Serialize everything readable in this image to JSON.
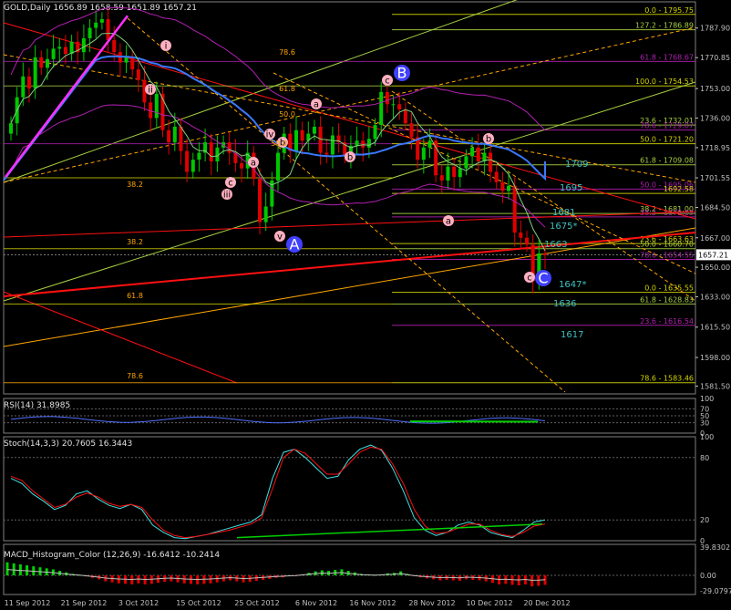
{
  "window": {
    "header": "GOLD,Daily  1656.89 1658.59 1651.89 1657.21",
    "rsi_header": "RSI(14) 31.8985",
    "stoch_header": "Stoch(14,3,3) 20.7605 16.3443",
    "macd_header": "MACD_Histogram_Color (12,26,9) -16.6412 -10.2414"
  },
  "colors": {
    "background": "#000000",
    "bull": "#00c800",
    "bear": "#e00000",
    "ma_blue": "#3a78ff",
    "trend_red": "#ff1010",
    "trend_orange": "#ffa500",
    "fib_yellow": "#d4d400",
    "fib_green": "#a8d040",
    "envelope": "#b020b0",
    "label_cyan": "#40c0c0",
    "label_pink": "#ffb0c0",
    "label_blue": "#8080ff"
  },
  "chart_data": {
    "type": "candlestick",
    "symbol": "GOLD",
    "timeframe": "Daily",
    "ylim": [
      1577,
      1803
    ],
    "price_ticks": [
      "1787.90",
      "1770.85",
      "1753.00",
      "1736.00",
      "1718.95",
      "1701.55",
      "1684.50",
      "1667.00",
      "1650.00",
      "1633.00",
      "1615.50",
      "1598.00",
      "1581.50"
    ],
    "last_price": "1657.21",
    "x_labels": [
      "11 Sep 2012",
      "21 Sep 2012",
      "3 Oct 2012",
      "15 Oct 2012",
      "25 Oct 2012",
      "6 Nov 2012",
      "16 Nov 2012",
      "28 Nov 2012",
      "10 Dec 2012",
      "20 Dec 2012"
    ],
    "closes": [
      1733,
      1748,
      1760,
      1753,
      1771,
      1765,
      1770,
      1776,
      1777,
      1773,
      1780,
      1774,
      1782,
      1788,
      1791,
      1793,
      1781,
      1774,
      1768,
      1771,
      1764,
      1758,
      1745,
      1736,
      1750,
      1729,
      1722,
      1731,
      1717,
      1705,
      1712,
      1716,
      1722,
      1711,
      1719,
      1722,
      1716,
      1710,
      1707,
      1716,
      1701,
      1676,
      1685,
      1700,
      1716,
      1727,
      1717,
      1729,
      1723,
      1727,
      1731,
      1716,
      1715,
      1726,
      1722,
      1714,
      1720,
      1723,
      1719,
      1724,
      1732,
      1751,
      1744,
      1744,
      1741,
      1733,
      1725,
      1712,
      1719,
      1723,
      1703,
      1700,
      1708,
      1702,
      1707,
      1714,
      1719,
      1711,
      1716,
      1705,
      1699,
      1694,
      1697,
      1670,
      1667,
      1663,
      1642,
      1658,
      1657
    ],
    "fib_levels": [
      {
        "label": "0.0 - 1795.75",
        "value": 1795.75
      },
      {
        "label": "127.2 - 1786.89",
        "value": 1786.89
      },
      {
        "label": "61.8 - 1768.67",
        "value": 1768.67
      },
      {
        "label": "100.0 - 1754.53",
        "value": 1754.53
      },
      {
        "label": "23.6 - 1732.01",
        "value": 1732.01
      },
      {
        "label": "78.6 - 1729.07",
        "value": 1729.07
      },
      {
        "label": "50.0 - 1721.20",
        "value": 1721.2
      },
      {
        "label": "61.8 - 1709.08",
        "value": 1709.08
      },
      {
        "label": "50.0 - 1695.06",
        "value": 1695.06
      },
      {
        "label": "1692.58",
        "value": 1692.58
      },
      {
        "label": "38.2 - 1681.00",
        "value": 1681.0
      },
      {
        "label": "38.2 - 1679.03",
        "value": 1679.03
      },
      {
        "label": "23.6 - 1663.63",
        "value": 1663.63
      },
      {
        "label": "50.0 - 1660.70",
        "value": 1660.7
      },
      {
        "label": "78.6 - 1654.55",
        "value": 1654.55
      },
      {
        "label": "0.0 - 1635.55",
        "value": 1635.55
      },
      {
        "label": "61.8 - 1628.83",
        "value": 1628.83
      },
      {
        "label": "23.6 - 1616.54",
        "value": 1616.54
      },
      {
        "label": "78.6 - 1583.46",
        "value": 1583.46
      }
    ],
    "side_fib_labels": [
      "78.6",
      "61.8",
      "50.0",
      "38.2",
      "38.2",
      "50.0",
      "61.8",
      "78.6"
    ],
    "target_labels": [
      "1709",
      "1695",
      "1681",
      "1675*",
      "1663",
      "1647*",
      "1636",
      "1617"
    ],
    "wave_labels": [
      "B",
      "A",
      "C",
      "c",
      "a",
      "b",
      "a",
      "b",
      "c",
      "i",
      "ii",
      "iii",
      "iv",
      "v",
      "a",
      "b",
      "c"
    ],
    "rsi": {
      "ticks": [
        "100",
        "70",
        "50",
        "30",
        "0"
      ],
      "value": 31.8985
    },
    "stoch": {
      "ticks": [
        "100",
        "80",
        "20",
        "0"
      ],
      "main": [
        60,
        55,
        45,
        38,
        30,
        34,
        45,
        48,
        40,
        34,
        31,
        35,
        30,
        15,
        8,
        3,
        2,
        4,
        6,
        9,
        12,
        15,
        18,
        25,
        60,
        85,
        88,
        80,
        70,
        60,
        62,
        78,
        88,
        92,
        87,
        70,
        48,
        22,
        10,
        5,
        8,
        15,
        18,
        15,
        8,
        5,
        3,
        10,
        18,
        20
      ],
      "signal": [
        62,
        58,
        48,
        40,
        32,
        35,
        42,
        46,
        42,
        36,
        33,
        35,
        32,
        20,
        10,
        5,
        3,
        4,
        6,
        8,
        10,
        13,
        16,
        22,
        50,
        80,
        88,
        84,
        74,
        64,
        64,
        74,
        85,
        90,
        88,
        74,
        55,
        30,
        14,
        7,
        8,
        12,
        16,
        16,
        10,
        6,
        4,
        8,
        14,
        16
      ]
    },
    "macd": {
      "ticks": [
        "39.8302",
        "0.00",
        "-29.0797"
      ],
      "value1": -16.6412,
      "value2": -10.2414,
      "hist": [
        26,
        24,
        22,
        20,
        18,
        16,
        14,
        12,
        9,
        6,
        3,
        1,
        -2,
        -5,
        -8,
        -12,
        -14,
        -16,
        -17,
        -18,
        -16,
        -18,
        -17,
        -15,
        -13,
        -12,
        -14,
        -16,
        -17,
        -18,
        -17,
        -16,
        -14,
        -12,
        -10,
        -12,
        -14,
        -13,
        -11,
        -9,
        -7,
        -5,
        -4,
        -2,
        -1,
        2,
        5,
        8,
        10,
        9,
        11,
        12,
        9,
        6,
        3,
        2,
        1,
        2,
        4,
        5,
        8,
        3,
        -1,
        -4,
        -6,
        -8,
        -10,
        -9,
        -10,
        -11,
        -8,
        -9,
        -10,
        -12,
        -15,
        -18,
        -17,
        -19,
        -20,
        -18,
        -22,
        -21,
        -19
      ]
    }
  }
}
